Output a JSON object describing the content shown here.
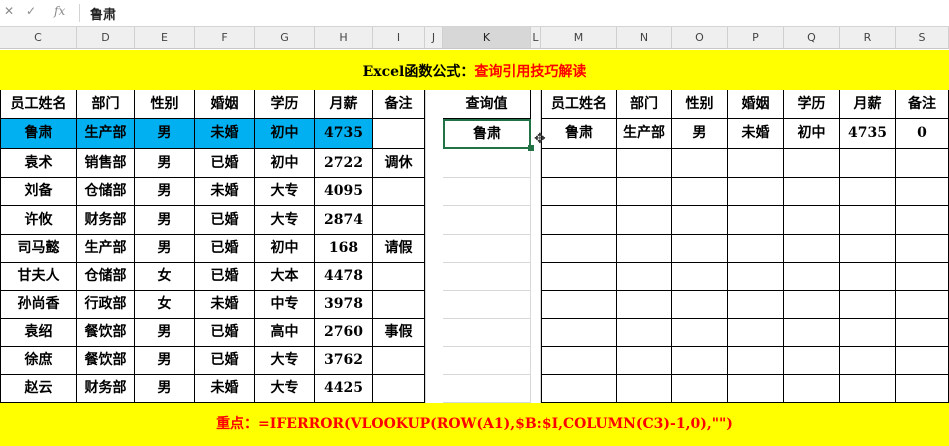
{
  "formula_bar": {
    "cancel_icon": "close-icon",
    "enter_icon": "check-icon",
    "fx_label": "fx",
    "value": "鲁肃"
  },
  "column_headers": [
    "C",
    "D",
    "E",
    "F",
    "G",
    "H",
    "I",
    "J",
    "K",
    "L",
    "M",
    "N",
    "O",
    "P",
    "Q",
    "R",
    "S"
  ],
  "selected_column": "K",
  "title": {
    "part1": "Excel函数公式：",
    "part2": "查询引用技巧解读"
  },
  "left_table": {
    "headers": [
      "员工姓名",
      "部门",
      "性别",
      "婚姻",
      "学历",
      "月薪",
      "备注"
    ],
    "rows": [
      [
        "鲁肃",
        "生产部",
        "男",
        "未婚",
        "初中",
        "4735",
        ""
      ],
      [
        "袁术",
        "销售部",
        "男",
        "已婚",
        "初中",
        "2722",
        "调休"
      ],
      [
        "刘备",
        "仓储部",
        "男",
        "未婚",
        "大专",
        "4095",
        ""
      ],
      [
        "许攸",
        "财务部",
        "男",
        "已婚",
        "大专",
        "2874",
        ""
      ],
      [
        "司马懿",
        "生产部",
        "男",
        "已婚",
        "初中",
        "168",
        "请假"
      ],
      [
        "甘夫人",
        "仓储部",
        "女",
        "已婚",
        "大本",
        "4478",
        ""
      ],
      [
        "孙尚香",
        "行政部",
        "女",
        "未婚",
        "中专",
        "3978",
        ""
      ],
      [
        "袁绍",
        "餐饮部",
        "男",
        "已婚",
        "高中",
        "2760",
        "事假"
      ],
      [
        "徐庶",
        "餐饮部",
        "男",
        "已婚",
        "大专",
        "3762",
        ""
      ],
      [
        "赵云",
        "财务部",
        "男",
        "未婚",
        "大专",
        "4425",
        ""
      ]
    ],
    "highlight_color": "#00b0f0"
  },
  "query": {
    "header": "查询值",
    "value": "鲁肃"
  },
  "right_table": {
    "headers": [
      "员工姓名",
      "部门",
      "性别",
      "婚姻",
      "学历",
      "月薪",
      "备注"
    ],
    "result": [
      "鲁肃",
      "生产部",
      "男",
      "未婚",
      "初中",
      "4735",
      "0"
    ]
  },
  "formula_note": "重点：=IFERROR(VLOOKUP(ROW(A1),$B:$I,COLUMN(C3)-1,0),\"\")",
  "colors": {
    "band": "#ffff00",
    "accent_red": "#ff0000",
    "selection": "#217346"
  }
}
